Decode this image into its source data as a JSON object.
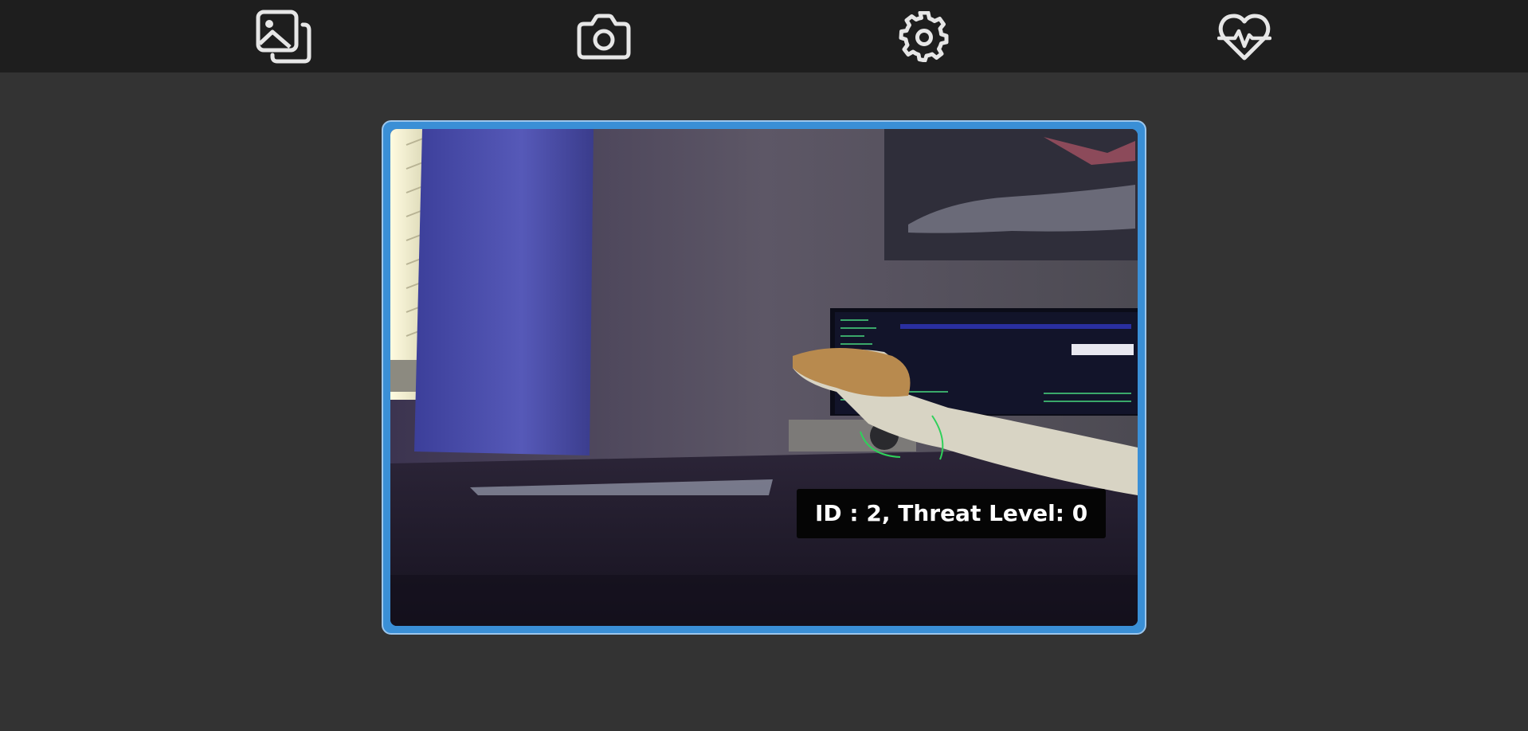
{
  "nav": {
    "items": [
      {
        "icon": "gallery-icon"
      },
      {
        "icon": "camera-icon"
      },
      {
        "icon": "settings-gear-icon"
      },
      {
        "icon": "heart-pulse-icon"
      }
    ]
  },
  "feed": {
    "overlay_label": "ID : 2, Threat Level: 0"
  },
  "colors": {
    "topbar": "#1e1e1e",
    "background": "#333333",
    "frame_accent": "#3a8fd6",
    "icon": "#e6e6e6"
  }
}
